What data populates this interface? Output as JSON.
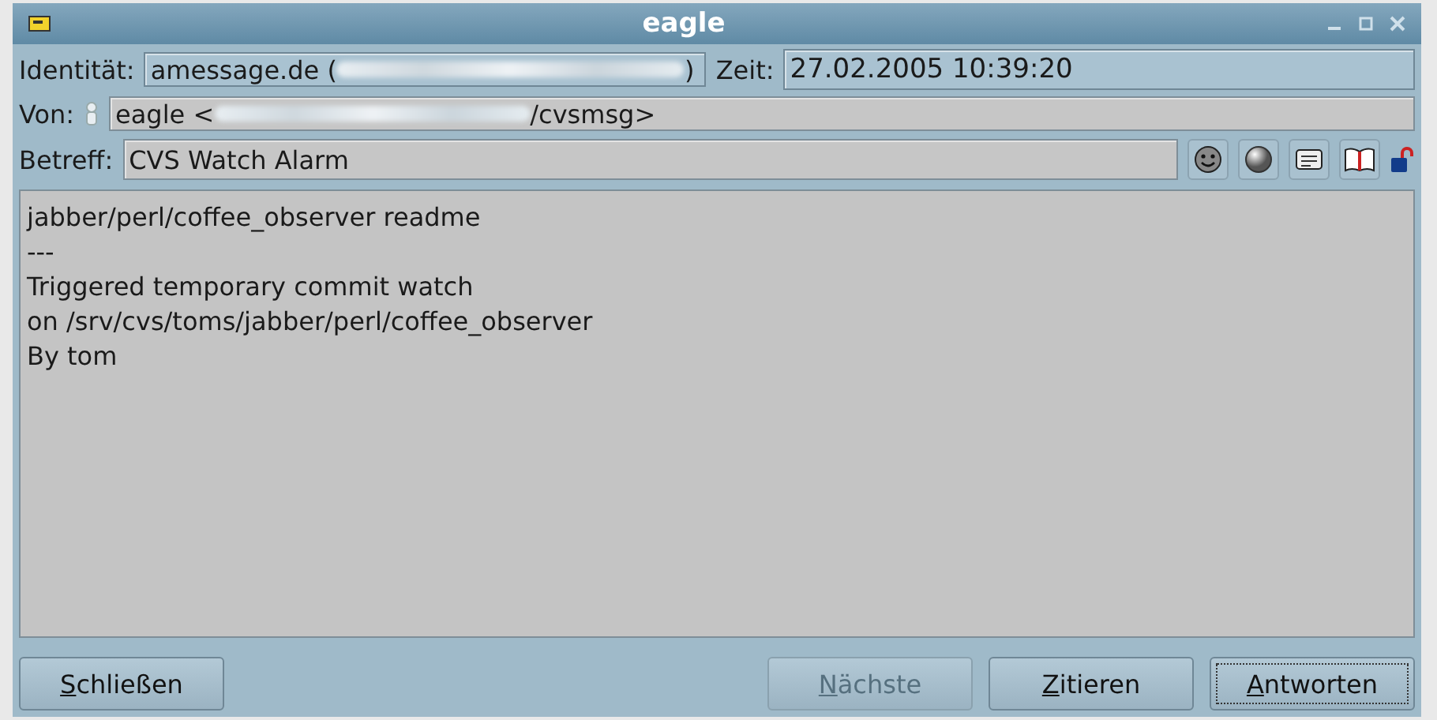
{
  "window": {
    "title": "eagle"
  },
  "identity": {
    "label": "Identität:",
    "value_start": "amessage.de (",
    "value_end": ")"
  },
  "time": {
    "label": "Zeit:",
    "value": "27.02.2005 10:39:20"
  },
  "from": {
    "label": "Von:",
    "value_start": "eagle <",
    "value_end": "/cvsmsg>"
  },
  "subject": {
    "label": "Betreff:",
    "value": "CVS Watch Alarm"
  },
  "body": [
    "jabber/perl/coffee_observer readme",
    "---",
    "Triggered temporary commit watch",
    "on /srv/cvs/toms/jabber/perl/coffee_observer",
    "By tom"
  ],
  "buttons": [
    {
      "label": "Schließen",
      "disabled": false,
      "focused": false
    },
    {
      "label": "Nächste",
      "disabled": true,
      "focused": false
    },
    {
      "label": "Zitieren",
      "disabled": false,
      "focused": false
    },
    {
      "label": "Antworten",
      "disabled": false,
      "focused": true
    }
  ]
}
